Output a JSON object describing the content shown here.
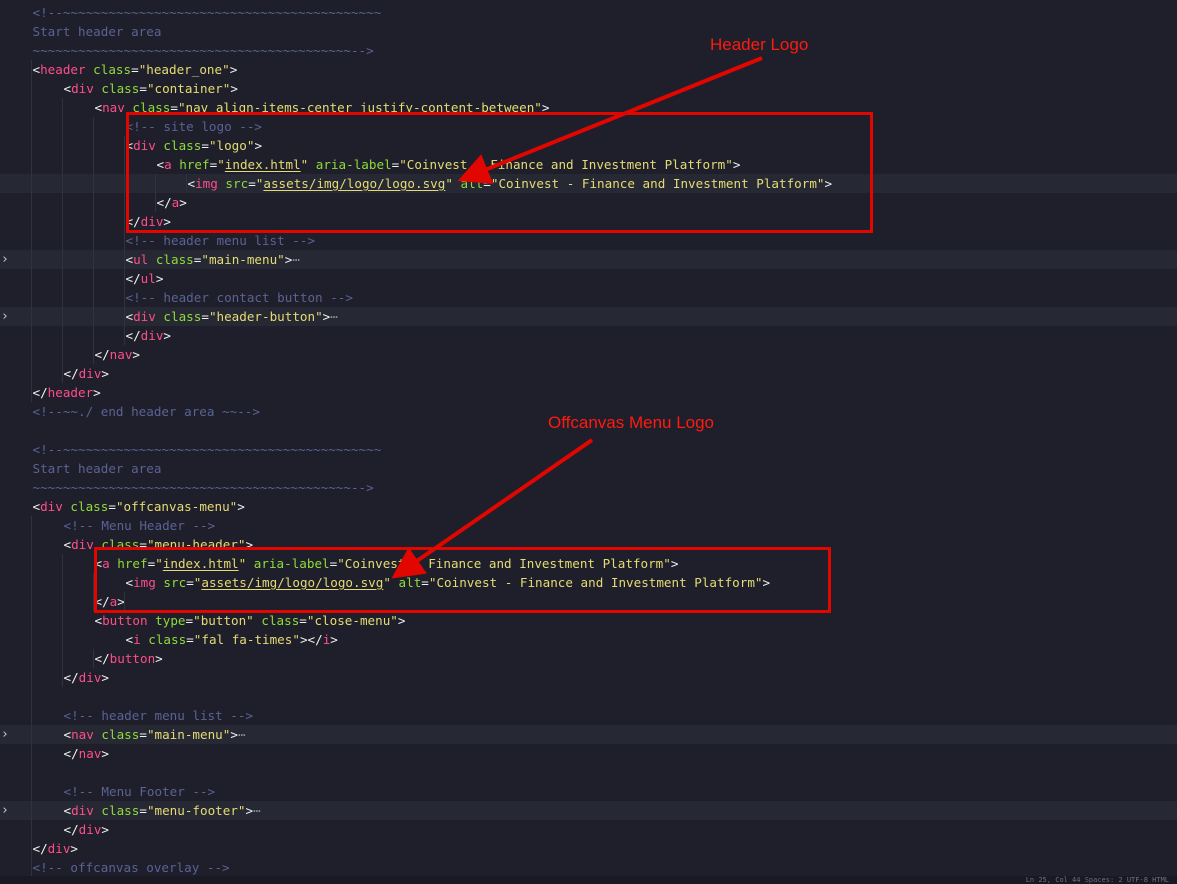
{
  "annotations": {
    "header_logo": "Header Logo",
    "offcanvas_logo": "Offcanvas Menu Logo"
  },
  "colors": {
    "background": "#1e1f2a",
    "comment": "#5b6294",
    "tag": "#ff4d8a",
    "attribute": "#8fdb3a",
    "string": "#e6db74",
    "annotation": "#e10600"
  },
  "folded_marker": "⋯",
  "status_text": "Ln 25, Col 44  Spaces: 2  UTF-8  HTML",
  "lines": [
    {
      "indent": 1,
      "tokens": [
        {
          "c": "c",
          "t": "<!--~~~~~~~~~~~~~~~~~~~~~~~~~~~~~~~~~~~~~~~~~~"
        }
      ]
    },
    {
      "indent": 1,
      "tokens": [
        {
          "c": "c",
          "t": "Start header area"
        }
      ]
    },
    {
      "indent": 1,
      "tokens": [
        {
          "c": "c",
          "t": "~~~~~~~~~~~~~~~~~~~~~~~~~~~~~~~~~~~~~~~~~~-->"
        }
      ]
    },
    {
      "indent": 1,
      "tokens": [
        {
          "c": "p",
          "t": "<"
        },
        {
          "c": "t",
          "t": "header"
        },
        {
          "c": "a",
          "t": " class"
        },
        {
          "c": "p",
          "t": "="
        },
        {
          "c": "s",
          "t": "\"header_one\""
        },
        {
          "c": "p",
          "t": ">"
        }
      ]
    },
    {
      "indent": 3,
      "tokens": [
        {
          "c": "p",
          "t": "<"
        },
        {
          "c": "t",
          "t": "div"
        },
        {
          "c": "a",
          "t": " class"
        },
        {
          "c": "p",
          "t": "="
        },
        {
          "c": "s",
          "t": "\"container\""
        },
        {
          "c": "p",
          "t": ">"
        }
      ]
    },
    {
      "indent": 5,
      "tokens": [
        {
          "c": "p",
          "t": "<"
        },
        {
          "c": "t",
          "t": "nav"
        },
        {
          "c": "a",
          "t": " class"
        },
        {
          "c": "p",
          "t": "="
        },
        {
          "c": "s",
          "t": "\"nav align-items-center justify-content-between\""
        },
        {
          "c": "p",
          "t": ">"
        }
      ]
    },
    {
      "indent": 7,
      "tokens": [
        {
          "c": "c",
          "t": "<!-- site logo -->"
        }
      ]
    },
    {
      "indent": 7,
      "tokens": [
        {
          "c": "p",
          "t": "<"
        },
        {
          "c": "t",
          "t": "div"
        },
        {
          "c": "a",
          "t": " class"
        },
        {
          "c": "p",
          "t": "="
        },
        {
          "c": "s",
          "t": "\"logo\""
        },
        {
          "c": "p",
          "t": ">"
        }
      ]
    },
    {
      "indent": 9,
      "tokens": [
        {
          "c": "p",
          "t": "<"
        },
        {
          "c": "t",
          "t": "a"
        },
        {
          "c": "a",
          "t": " href"
        },
        {
          "c": "p",
          "t": "="
        },
        {
          "c": "s",
          "t": "\""
        },
        {
          "c": "u",
          "t": "index.html"
        },
        {
          "c": "s",
          "t": "\""
        },
        {
          "c": "a",
          "t": " aria-label"
        },
        {
          "c": "p",
          "t": "="
        },
        {
          "c": "s",
          "t": "\"Coinvest - Finance and Investment Platform\""
        },
        {
          "c": "p",
          "t": ">"
        }
      ]
    },
    {
      "indent": 11,
      "hl": true,
      "tokens": [
        {
          "c": "p",
          "t": "<"
        },
        {
          "c": "t",
          "t": "img"
        },
        {
          "c": "a",
          "t": " src"
        },
        {
          "c": "p",
          "t": "="
        },
        {
          "c": "s",
          "t": "\""
        },
        {
          "c": "u",
          "t": "assets/img/logo/logo.svg"
        },
        {
          "c": "s",
          "t": "\""
        },
        {
          "c": "a",
          "t": " alt"
        },
        {
          "c": "p",
          "t": "="
        },
        {
          "c": "s",
          "t": "\"Coinvest - Finance and Investment Platform\""
        },
        {
          "c": "p",
          "t": ">"
        }
      ]
    },
    {
      "indent": 9,
      "tokens": [
        {
          "c": "p",
          "t": "</"
        },
        {
          "c": "t",
          "t": "a"
        },
        {
          "c": "p",
          "t": ">"
        }
      ]
    },
    {
      "indent": 7,
      "tokens": [
        {
          "c": "p",
          "t": "</"
        },
        {
          "c": "t",
          "t": "div"
        },
        {
          "c": "p",
          "t": ">"
        }
      ]
    },
    {
      "indent": 7,
      "tokens": [
        {
          "c": "c",
          "t": "<!-- header menu list -->"
        }
      ]
    },
    {
      "indent": 7,
      "hl": true,
      "fold": true,
      "tokens": [
        {
          "c": "p",
          "t": "<"
        },
        {
          "c": "t",
          "t": "ul"
        },
        {
          "c": "a",
          "t": " class"
        },
        {
          "c": "p",
          "t": "="
        },
        {
          "c": "s",
          "t": "\"main-menu\""
        },
        {
          "c": "p",
          "t": ">"
        }
      ]
    },
    {
      "indent": 7,
      "tokens": [
        {
          "c": "p",
          "t": "</"
        },
        {
          "c": "t",
          "t": "ul"
        },
        {
          "c": "p",
          "t": ">"
        }
      ]
    },
    {
      "indent": 7,
      "tokens": [
        {
          "c": "c",
          "t": "<!-- header contact button -->"
        }
      ]
    },
    {
      "indent": 7,
      "hl": true,
      "fold": true,
      "tokens": [
        {
          "c": "p",
          "t": "<"
        },
        {
          "c": "t",
          "t": "div"
        },
        {
          "c": "a",
          "t": " class"
        },
        {
          "c": "p",
          "t": "="
        },
        {
          "c": "s",
          "t": "\"header-button\""
        },
        {
          "c": "p",
          "t": ">"
        }
      ]
    },
    {
      "indent": 7,
      "tokens": [
        {
          "c": "p",
          "t": "</"
        },
        {
          "c": "t",
          "t": "div"
        },
        {
          "c": "p",
          "t": ">"
        }
      ]
    },
    {
      "indent": 5,
      "tokens": [
        {
          "c": "p",
          "t": "</"
        },
        {
          "c": "t",
          "t": "nav"
        },
        {
          "c": "p",
          "t": ">"
        }
      ]
    },
    {
      "indent": 3,
      "tokens": [
        {
          "c": "p",
          "t": "</"
        },
        {
          "c": "t",
          "t": "div"
        },
        {
          "c": "p",
          "t": ">"
        }
      ]
    },
    {
      "indent": 1,
      "tokens": [
        {
          "c": "p",
          "t": "</"
        },
        {
          "c": "t",
          "t": "header"
        },
        {
          "c": "p",
          "t": ">"
        }
      ]
    },
    {
      "indent": 1,
      "tokens": [
        {
          "c": "c",
          "t": "<!--~~./ end header area ~~-->"
        }
      ]
    },
    {
      "indent": 1,
      "tokens": []
    },
    {
      "indent": 1,
      "tokens": [
        {
          "c": "c",
          "t": "<!--~~~~~~~~~~~~~~~~~~~~~~~~~~~~~~~~~~~~~~~~~~"
        }
      ]
    },
    {
      "indent": 1,
      "tokens": [
        {
          "c": "c",
          "t": "Start header area"
        }
      ]
    },
    {
      "indent": 1,
      "tokens": [
        {
          "c": "c",
          "t": "~~~~~~~~~~~~~~~~~~~~~~~~~~~~~~~~~~~~~~~~~~-->"
        }
      ]
    },
    {
      "indent": 1,
      "tokens": [
        {
          "c": "p",
          "t": "<"
        },
        {
          "c": "t",
          "t": "div"
        },
        {
          "c": "a",
          "t": " class"
        },
        {
          "c": "p",
          "t": "="
        },
        {
          "c": "s",
          "t": "\"offcanvas-menu\""
        },
        {
          "c": "p",
          "t": ">"
        }
      ]
    },
    {
      "indent": 3,
      "tokens": [
        {
          "c": "c",
          "t": "<!-- Menu Header -->"
        }
      ]
    },
    {
      "indent": 3,
      "tokens": [
        {
          "c": "p",
          "t": "<"
        },
        {
          "c": "t",
          "t": "div"
        },
        {
          "c": "a",
          "t": " class"
        },
        {
          "c": "p",
          "t": "="
        },
        {
          "c": "s",
          "t": "\"menu-header\""
        },
        {
          "c": "p",
          "t": ">"
        }
      ]
    },
    {
      "indent": 5,
      "tokens": [
        {
          "c": "p",
          "t": "<"
        },
        {
          "c": "t",
          "t": "a"
        },
        {
          "c": "a",
          "t": " href"
        },
        {
          "c": "p",
          "t": "="
        },
        {
          "c": "s",
          "t": "\""
        },
        {
          "c": "u",
          "t": "index.html"
        },
        {
          "c": "s",
          "t": "\""
        },
        {
          "c": "a",
          "t": " aria-label"
        },
        {
          "c": "p",
          "t": "="
        },
        {
          "c": "s",
          "t": "\"Coinvest - Finance and Investment Platform\""
        },
        {
          "c": "p",
          "t": ">"
        }
      ]
    },
    {
      "indent": 7,
      "tokens": [
        {
          "c": "p",
          "t": "<"
        },
        {
          "c": "t",
          "t": "img"
        },
        {
          "c": "a",
          "t": " src"
        },
        {
          "c": "p",
          "t": "="
        },
        {
          "c": "s",
          "t": "\""
        },
        {
          "c": "u",
          "t": "assets/img/logo/logo.svg"
        },
        {
          "c": "s",
          "t": "\""
        },
        {
          "c": "a",
          "t": " alt"
        },
        {
          "c": "p",
          "t": "="
        },
        {
          "c": "s",
          "t": "\"Coinvest - Finance and Investment Platform\""
        },
        {
          "c": "p",
          "t": ">"
        }
      ]
    },
    {
      "indent": 5,
      "tokens": [
        {
          "c": "p",
          "t": "</"
        },
        {
          "c": "t",
          "t": "a"
        },
        {
          "c": "p",
          "t": ">"
        }
      ]
    },
    {
      "indent": 5,
      "tokens": [
        {
          "c": "p",
          "t": "<"
        },
        {
          "c": "t",
          "t": "button"
        },
        {
          "c": "a",
          "t": " type"
        },
        {
          "c": "p",
          "t": "="
        },
        {
          "c": "s",
          "t": "\"button\""
        },
        {
          "c": "a",
          "t": " class"
        },
        {
          "c": "p",
          "t": "="
        },
        {
          "c": "s",
          "t": "\"close-menu\""
        },
        {
          "c": "p",
          "t": ">"
        }
      ]
    },
    {
      "indent": 7,
      "tokens": [
        {
          "c": "p",
          "t": "<"
        },
        {
          "c": "t",
          "t": "i"
        },
        {
          "c": "a",
          "t": " class"
        },
        {
          "c": "p",
          "t": "="
        },
        {
          "c": "s",
          "t": "\"fal fa-times\""
        },
        {
          "c": "p",
          "t": "></"
        },
        {
          "c": "t",
          "t": "i"
        },
        {
          "c": "p",
          "t": ">"
        }
      ]
    },
    {
      "indent": 5,
      "tokens": [
        {
          "c": "p",
          "t": "</"
        },
        {
          "c": "t",
          "t": "button"
        },
        {
          "c": "p",
          "t": ">"
        }
      ]
    },
    {
      "indent": 3,
      "tokens": [
        {
          "c": "p",
          "t": "</"
        },
        {
          "c": "t",
          "t": "div"
        },
        {
          "c": "p",
          "t": ">"
        }
      ]
    },
    {
      "indent": 3,
      "tokens": []
    },
    {
      "indent": 3,
      "tokens": [
        {
          "c": "c",
          "t": "<!-- header menu list -->"
        }
      ]
    },
    {
      "indent": 3,
      "hl": true,
      "fold": true,
      "tokens": [
        {
          "c": "p",
          "t": "<"
        },
        {
          "c": "t",
          "t": "nav"
        },
        {
          "c": "a",
          "t": " class"
        },
        {
          "c": "p",
          "t": "="
        },
        {
          "c": "s",
          "t": "\"main-menu\""
        },
        {
          "c": "p",
          "t": ">"
        }
      ]
    },
    {
      "indent": 3,
      "tokens": [
        {
          "c": "p",
          "t": "</"
        },
        {
          "c": "t",
          "t": "nav"
        },
        {
          "c": "p",
          "t": ">"
        }
      ]
    },
    {
      "indent": 3,
      "tokens": []
    },
    {
      "indent": 3,
      "tokens": [
        {
          "c": "c",
          "t": "<!-- Menu Footer -->"
        }
      ]
    },
    {
      "indent": 3,
      "hl": true,
      "fold": true,
      "tokens": [
        {
          "c": "p",
          "t": "<"
        },
        {
          "c": "t",
          "t": "div"
        },
        {
          "c": "a",
          "t": " class"
        },
        {
          "c": "p",
          "t": "="
        },
        {
          "c": "s",
          "t": "\"menu-footer\""
        },
        {
          "c": "p",
          "t": ">"
        }
      ]
    },
    {
      "indent": 3,
      "tokens": [
        {
          "c": "p",
          "t": "</"
        },
        {
          "c": "t",
          "t": "div"
        },
        {
          "c": "p",
          "t": ">"
        }
      ]
    },
    {
      "indent": 1,
      "tokens": [
        {
          "c": "p",
          "t": "</"
        },
        {
          "c": "t",
          "t": "div"
        },
        {
          "c": "p",
          "t": ">"
        }
      ]
    },
    {
      "indent": 1,
      "tokens": [
        {
          "c": "c",
          "t": "<!-- offcanvas overlay -->"
        }
      ]
    }
  ]
}
